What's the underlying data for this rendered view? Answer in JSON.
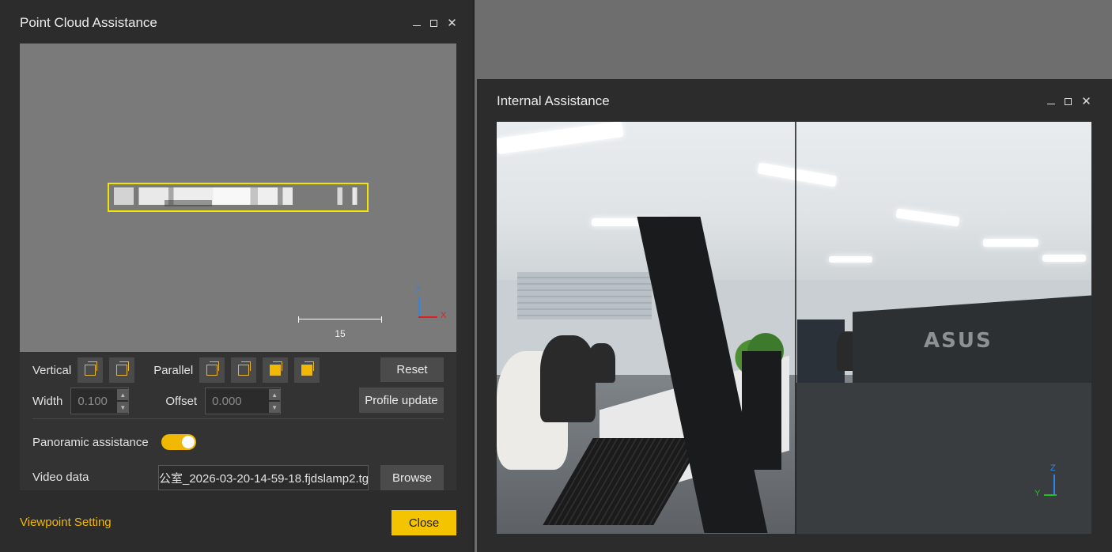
{
  "left_window": {
    "title": "Point Cloud Assistance",
    "viewport": {
      "scale_label": "15",
      "axis_z": "Z",
      "axis_x": "X"
    },
    "controls": {
      "vertical_label": "Vertical",
      "parallel_label": "Parallel",
      "reset_label": "Reset",
      "width_label": "Width",
      "width_value": "0.100",
      "offset_label": "Offset",
      "offset_value": "0.000",
      "profile_update_label": "Profile update",
      "panoramic_label": "Panoramic assistance",
      "panoramic_on": true,
      "video_label": "Video data",
      "video_value": "公室_2026-03-20-14-59-18.fjdslamp2.tgz",
      "browse_label": "Browse"
    },
    "footer": {
      "viewpoint_link": "Viewpoint Setting",
      "close_label": "Close"
    }
  },
  "right_window": {
    "title": "Internal Assistance",
    "brand_text": "ASUS",
    "axis_z": "Z",
    "axis_y": "Y"
  },
  "colors": {
    "accent": "#F5C400",
    "selection_box": "#F2E600",
    "window_bg": "#2C2C2C",
    "desktop_bg": "#6E6E6E"
  },
  "icons": {
    "window_minimize": "minimize-icon",
    "window_maximize": "maximize-icon",
    "window_close": "close-icon"
  }
}
